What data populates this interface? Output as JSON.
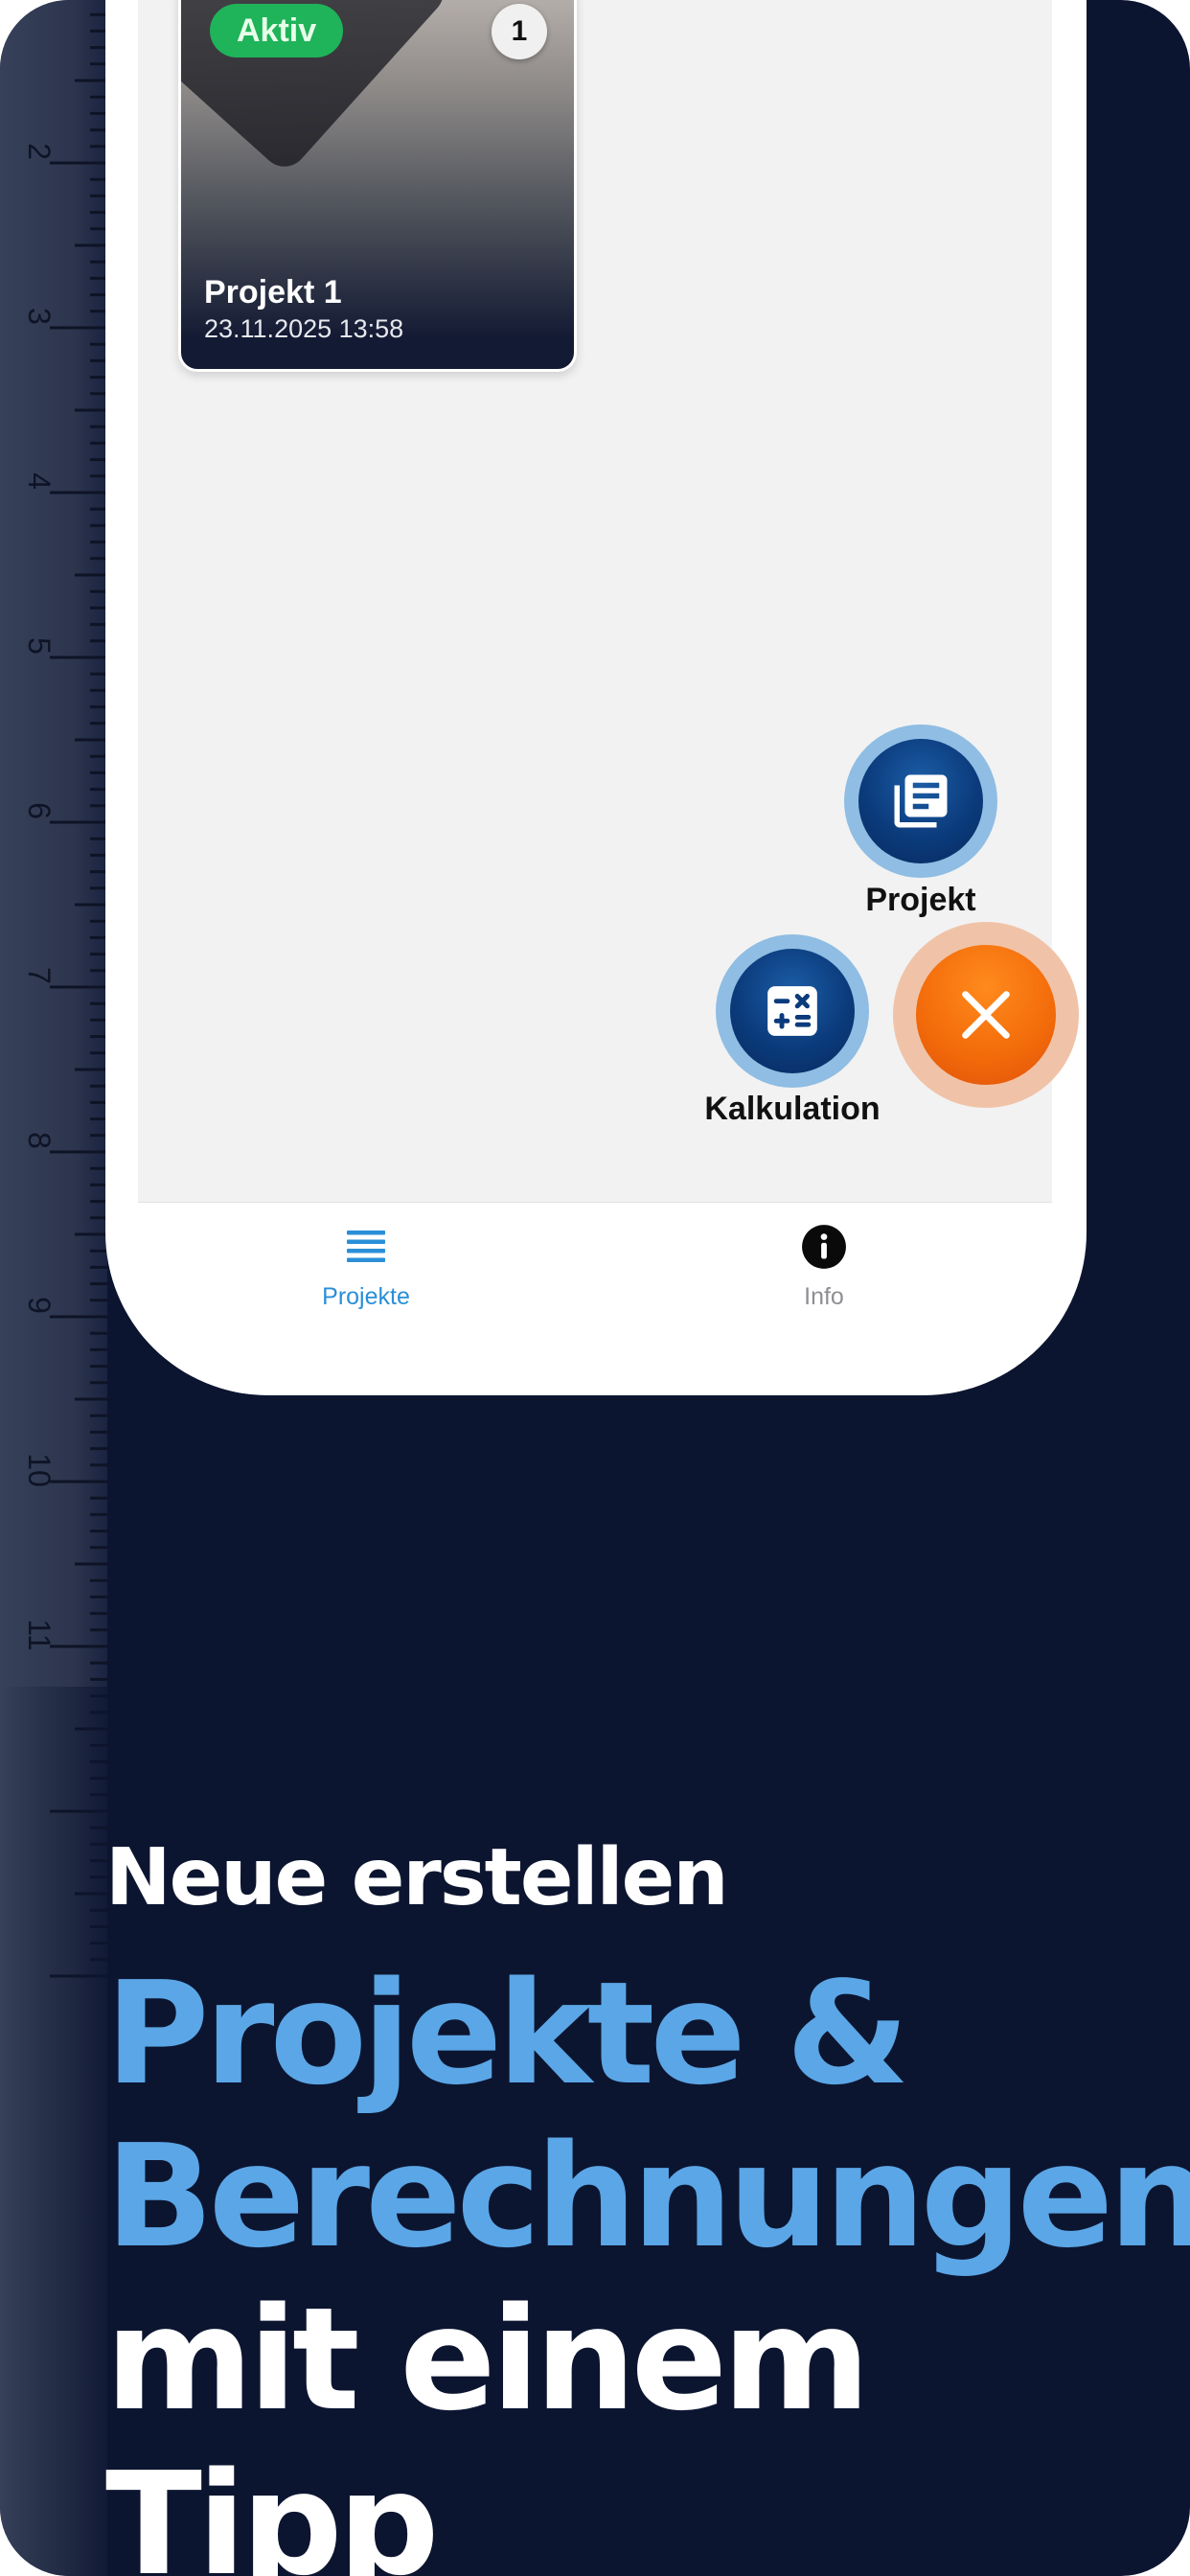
{
  "card": {
    "status_badge": "Aktiv",
    "count_badge": "1",
    "title": "Projekt 1",
    "date": "23.11.2025 13:58"
  },
  "fab_menu": {
    "projekt_label": "Projekt",
    "kalkulation_label": "Kalkulation",
    "projekt_icon": "document-stack-icon",
    "kalkulation_icon": "calculator-icon",
    "close_icon": "close-icon"
  },
  "tabbar": {
    "tabs": [
      {
        "label": "Projekte",
        "icon": "list-icon",
        "active": true
      },
      {
        "label": "Info",
        "icon": "info-icon",
        "active": false
      }
    ]
  },
  "ruler": {
    "numbers": [
      "2",
      "3",
      "4",
      "5",
      "6",
      "7",
      "8",
      "9",
      "10",
      "11"
    ]
  },
  "headline": {
    "subtitle": "Neue erstellen",
    "line1": "Projekte &",
    "line2": "Berechnungen",
    "line3": "mit einem Tipp"
  },
  "colors": {
    "background": "#0c1530",
    "accent_blue": "#5ba6e6",
    "tab_active": "#2a8fd8",
    "tab_inactive": "#8e8e93",
    "fab_orange": "#f26a0a",
    "badge_green": "#1fb35a"
  }
}
